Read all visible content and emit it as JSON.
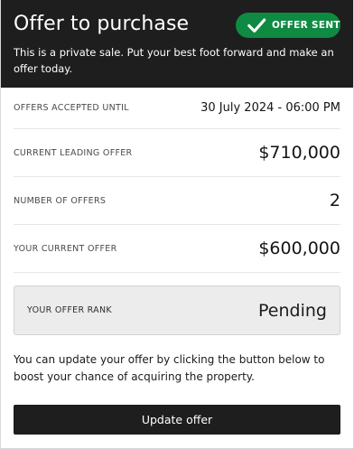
{
  "header": {
    "title": "Offer to purchase",
    "badge_label": "OFFER SENT",
    "badge_icon": "check-icon",
    "subtitle": "This is a private sale. Put your best foot forward and make an offer today."
  },
  "details": [
    {
      "label": "OFFERS ACCEPTED UNTIL",
      "value": "30 July 2024 - 06:00 PM"
    },
    {
      "label": "CURRENT LEADING OFFER",
      "value": "$710,000"
    },
    {
      "label": "NUMBER OF OFFERS",
      "value": "2"
    },
    {
      "label": "YOUR CURRENT OFFER",
      "value": "$600,000"
    }
  ],
  "rank": {
    "label": "YOUR OFFER RANK",
    "value": "Pending"
  },
  "info_text": "You can update your offer by clicking the button below to boost your chance of acquiring the property.",
  "update_button_label": "Update offer",
  "colors": {
    "header_bg": "#1e1e1e",
    "badge_green": "#0e8a43",
    "button_bg": "#1e1e1e",
    "rank_bg": "#ececec"
  }
}
